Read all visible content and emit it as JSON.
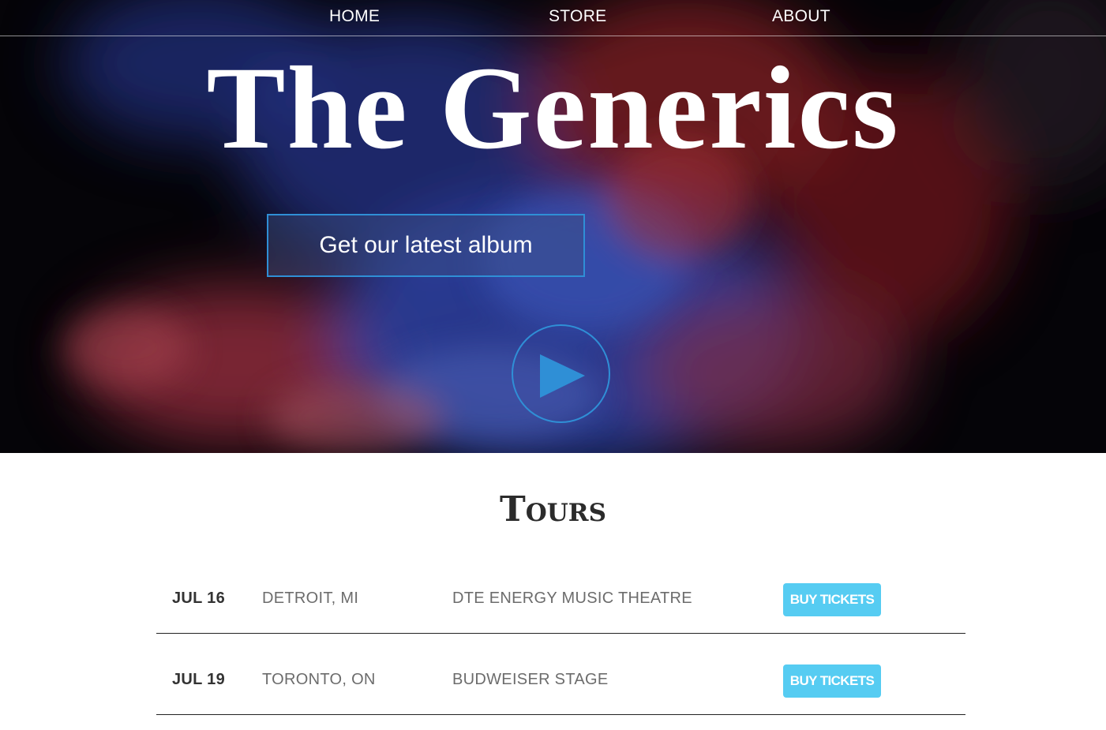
{
  "nav": {
    "home_label": "HOME",
    "store_label": "STORE",
    "about_label": "ABOUT"
  },
  "hero": {
    "title": "The Generics",
    "album_button_label": "Get our latest album",
    "play_icon": "play-icon"
  },
  "tours": {
    "heading": "Tours",
    "rows": [
      {
        "date": "JUL 16",
        "city": "DETROIT, MI",
        "venue": "DTE ENERGY MUSIC THEATRE",
        "button_label": "BUY TICKETS"
      },
      {
        "date": "JUL 19",
        "city": "TORONTO, ON",
        "venue": "BUDWEISER STAGE",
        "button_label": "BUY TICKETS"
      }
    ]
  },
  "colors": {
    "accent_blue": "#2f8fd6",
    "buy_button": "#56ccf2",
    "hero_background": "#07050a",
    "smoke_blue": "#3b5bd1",
    "smoke_red": "#d0363b"
  }
}
